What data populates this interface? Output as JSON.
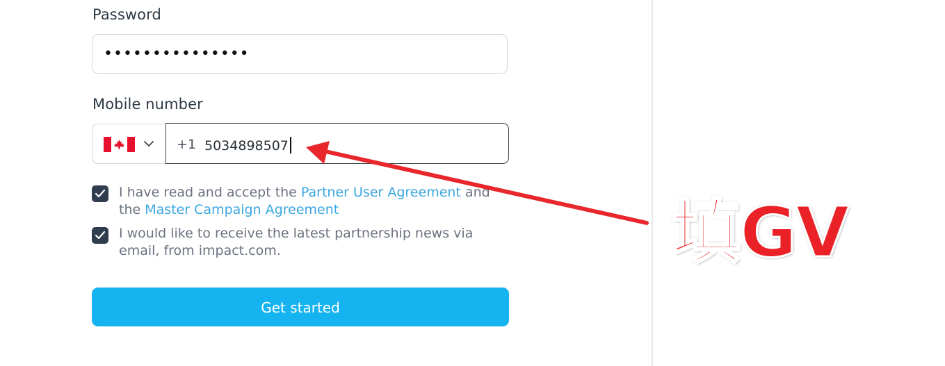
{
  "form": {
    "password": {
      "label": "Password",
      "value": "•••••••••••••••"
    },
    "mobile": {
      "label": "Mobile number",
      "country": "Canada",
      "dial_code": "+1",
      "value": "5034898507"
    },
    "agreement": {
      "checked": true,
      "text_before": " I have read and accept the ",
      "link1": "Partner User Agreement",
      "text_mid": " and the ",
      "link2": "Master Campaign Agreement"
    },
    "newsletter": {
      "checked": true,
      "text": " I would like to receive the latest partnership news via email, from impact.com."
    },
    "submit_label": "Get started"
  },
  "annotation": {
    "text": "填GV",
    "color": "#ea2127"
  },
  "colors": {
    "accent": "#16b3f1",
    "link": "#3aa6e0",
    "checkbox": "#2f3d4e"
  },
  "icons": {
    "flag": "canada-flag-icon",
    "chevron": "chevron-down-icon",
    "check": "check-icon"
  }
}
